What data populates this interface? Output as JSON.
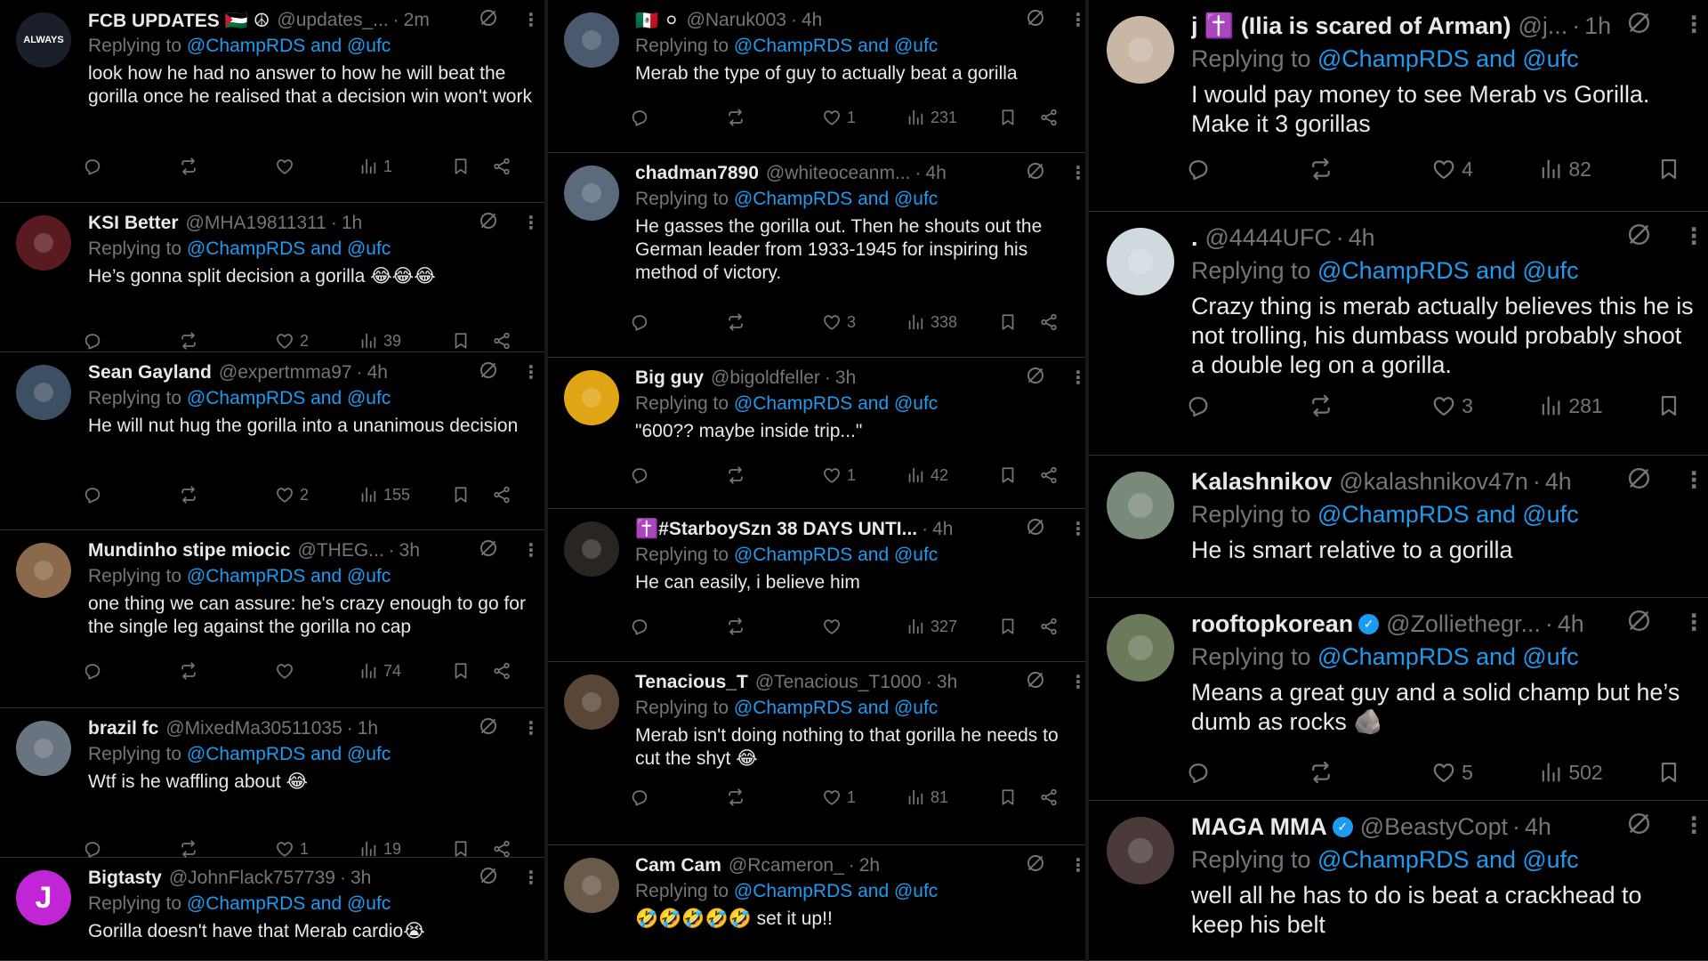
{
  "replying_prefix": "Replying to",
  "replying_targets": "@ChampRDS and @ufc",
  "columns": [
    {
      "replies": [
        {
          "name": "FCB UPDATES 🇵🇸 ☮",
          "handle": "@updates_...",
          "time": "2m",
          "avatar_text": "ALWAYS",
          "avatar_color": "#1a1f2a",
          "text": "look how he had no answer to how he will beat the gorilla once he realised that a decision win won't work",
          "likes": "",
          "views": "1"
        },
        {
          "name": "KSI Better",
          "handle": "@MHA19811311",
          "time": "1h",
          "avatar_text": "",
          "avatar_color": "#5a1a22",
          "text": "He’s gonna split decision a gorilla 😂😂😂",
          "likes": "2",
          "views": "39"
        },
        {
          "name": "Sean Gayland",
          "handle": "@expertmma97",
          "time": "4h",
          "avatar_text": "",
          "avatar_color": "#3d4f63",
          "text": "He will nut hug the gorilla into a unanimous decision",
          "likes": "2",
          "views": "155"
        },
        {
          "name": "Mundinho stipe miocic",
          "handle": "@THEG...",
          "time": "3h",
          "avatar_text": "",
          "avatar_color": "#8a6a4a",
          "text": "one thing we can assure: he's crazy enough to go for the single leg against the gorilla no cap",
          "likes": "",
          "views": "74"
        },
        {
          "name": "brazil fc",
          "handle": "@MixedMa30511035",
          "time": "1h",
          "avatar_text": "",
          "avatar_color": "#6a7380",
          "text": "Wtf is he waffling about 😂",
          "likes": "1",
          "views": "19"
        },
        {
          "name": "Bigtasty",
          "handle": "@JohnFlack757739",
          "time": "3h",
          "avatar_text": "J",
          "avatar_color": "#c026d3",
          "text": "Gorilla doesn't have that Merab cardio😭",
          "likes": "",
          "views": ""
        }
      ]
    },
    {
      "replies": [
        {
          "name": "🇲🇽 ⚪",
          "handle": "@Naruk003",
          "time": "4h",
          "avatar_text": "",
          "avatar_color": "#4a5a6e",
          "text": "Merab the type of guy to actually beat a gorilla",
          "likes": "1",
          "views": "231"
        },
        {
          "name": "chadman7890",
          "handle": "@whiteoceanm...",
          "time": "4h",
          "avatar_text": "",
          "avatar_color": "#5b6b7d",
          "text": "He gasses the gorilla out. Then he shouts out the German leader from 1933-1945 for inspiring his method of victory.",
          "likes": "3",
          "views": "338"
        },
        {
          "name": "Big guy",
          "handle": "@bigoldfeller",
          "time": "3h",
          "avatar_text": "",
          "avatar_color": "#e0a514",
          "text": "\"600?? maybe inside trip...\"",
          "likes": "1",
          "views": "42"
        },
        {
          "name": "✝️#StarboySzn 38 DAYS UNTI...",
          "handle": "",
          "time": "4h",
          "avatar_text": "",
          "avatar_color": "#2a2520",
          "text": "He can easily, i believe him",
          "likes": "",
          "views": "327"
        },
        {
          "name": "Tenacious_T",
          "handle": "@Tenacious_T1000",
          "time": "3h",
          "avatar_text": "",
          "avatar_color": "#5a4636",
          "text": "Merab isn't doing nothing to that gorilla he needs to cut the shyt 😂",
          "likes": "1",
          "views": "81"
        },
        {
          "name": "Cam Cam",
          "handle": "@Rcameron_",
          "time": "2h",
          "avatar_text": "",
          "avatar_color": "#6a5a4a",
          "text": "🤣🤣🤣🤣🤣 set it up!!",
          "likes": "",
          "views": ""
        }
      ]
    },
    {
      "replies": [
        {
          "name": "j ✝️ (Ilia is scared of Arman)",
          "handle": "@j...",
          "time": "1h",
          "avatar_text": "",
          "avatar_color": "#c9b6a4",
          "text": "I would pay money to see Merab vs Gorilla. Make it 3 gorillas",
          "likes": "4",
          "views": "82"
        },
        {
          "name": ".",
          "handle": "@4444UFC",
          "time": "4h",
          "avatar_text": "",
          "avatar_color": "#cfd9de",
          "text": "Crazy thing is merab actually believes this he is not trolling, his dumbass would probably shoot a double leg on a gorilla.",
          "likes": "3",
          "views": "281"
        },
        {
          "name": "Kalashnikov",
          "handle": "@kalashnikov47n",
          "time": "4h",
          "avatar_text": "",
          "avatar_color": "#7a8a7a",
          "text": "He is smart relative to a gorilla",
          "likes": "",
          "views": ""
        },
        {
          "name": "rooftopkorean",
          "handle": "@Zolliethegr...",
          "time": "4h",
          "avatar_text": "",
          "avatar_color": "#6b7a5a",
          "text": "Means a great guy and a solid champ but he’s dumb as rocks 🪨",
          "likes": "5",
          "views": "502"
        },
        {
          "name": "MAGA MMA",
          "handle": "@BeastyCopt",
          "time": "4h",
          "avatar_text": "",
          "avatar_color": "#4a3a3a",
          "text": "well all he has to do is beat a crackhead to keep his belt",
          "likes": "",
          "views": ""
        }
      ]
    }
  ]
}
